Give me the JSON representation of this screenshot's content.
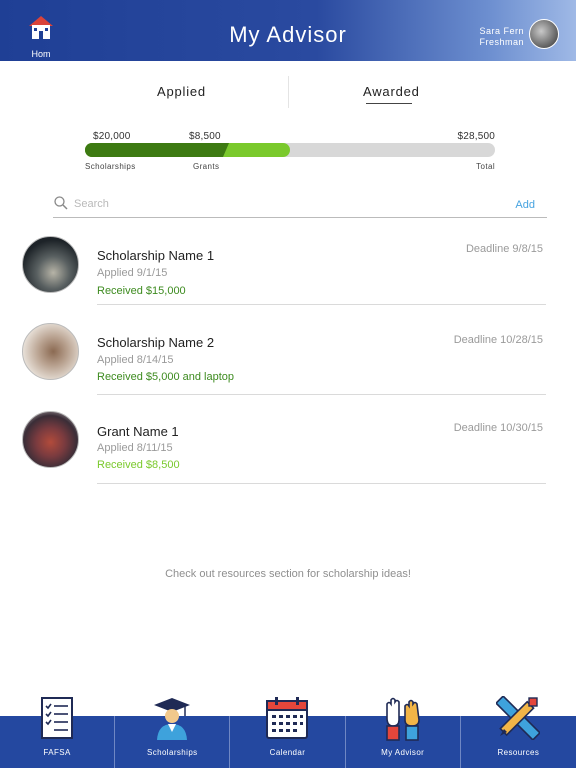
{
  "header": {
    "title": "My Advisor",
    "home_label": "Hom",
    "user_name": "Sara Fern",
    "user_level": "Freshman"
  },
  "tabs": {
    "applied": "Applied",
    "awarded": "Awarded",
    "active": "Awarded"
  },
  "progress": {
    "scholarships_value": "$20,000",
    "grants_value": "$8,500",
    "total_value": "$28,500",
    "scholarships_label": "Scholarships",
    "grants_label": "Grants",
    "total_label": "Total",
    "scholarships_amount": 20000,
    "grants_amount": 8500,
    "max_amount": 57000
  },
  "search": {
    "placeholder": "Search",
    "add_label": "Add"
  },
  "awards": [
    {
      "name": "Scholarship Name 1",
      "applied": "Applied 9/1/15",
      "received": "Received $15,000",
      "deadline": "Deadline 9/8/15"
    },
    {
      "name": "Scholarship Name 2",
      "applied": "Applied 8/14/15",
      "received": "Received $5,000 and laptop",
      "deadline": "Deadline 10/28/15"
    },
    {
      "name": "Grant Name 1",
      "applied": "Applied 8/11/15",
      "received": "Received $8,500",
      "deadline": "Deadline 10/30/15"
    }
  ],
  "resource_hint": "Check out resources section for scholarship ideas!",
  "nav": {
    "items": [
      {
        "label": "FAFSA",
        "icon": "checklist-icon"
      },
      {
        "label": "Scholarships",
        "icon": "graduate-icon"
      },
      {
        "label": "Calendar",
        "icon": "calendar-icon"
      },
      {
        "label": "My Advisor",
        "icon": "raised-hands-icon"
      },
      {
        "label": "Resources",
        "icon": "pencil-ruler-icon"
      }
    ]
  },
  "colors": {
    "header": "#1f3f95",
    "nav": "#2448a0",
    "scholarship_fill": "#3d7a12",
    "grant_fill": "#7ac92c",
    "link": "#46a3e0"
  }
}
